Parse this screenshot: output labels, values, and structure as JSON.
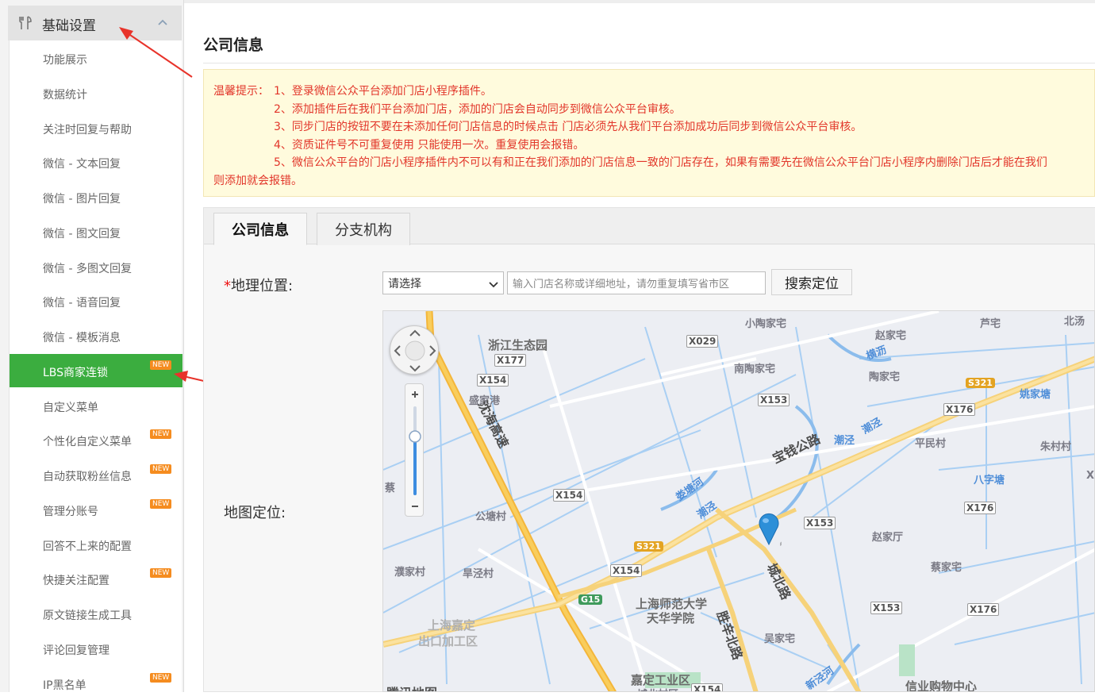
{
  "sidebar": {
    "group_title": "基础设置",
    "items": [
      {
        "label": "功能展示",
        "badge": ""
      },
      {
        "label": "数据统计",
        "badge": ""
      },
      {
        "label": "关注时回复与帮助",
        "badge": ""
      },
      {
        "label": "微信 - 文本回复",
        "badge": ""
      },
      {
        "label": "微信 - 图片回复",
        "badge": ""
      },
      {
        "label": "微信 - 图文回复",
        "badge": ""
      },
      {
        "label": "微信 - 多图文回复",
        "badge": ""
      },
      {
        "label": "微信 - 语音回复",
        "badge": ""
      },
      {
        "label": "微信 - 模板消息",
        "badge": ""
      },
      {
        "label": "LBS商家连锁",
        "badge": "NEW",
        "active": true
      },
      {
        "label": "自定义菜单",
        "badge": ""
      },
      {
        "label": "个性化自定义菜单",
        "badge": "NEW"
      },
      {
        "label": "自动获取粉丝信息",
        "badge": "NEW"
      },
      {
        "label": "管理分账号",
        "badge": "NEW"
      },
      {
        "label": "回答不上来的配置",
        "badge": ""
      },
      {
        "label": "快捷关注配置",
        "badge": "NEW"
      },
      {
        "label": "原文链接生成工具",
        "badge": ""
      },
      {
        "label": "评论回复管理",
        "badge": ""
      },
      {
        "label": "IP黑名单",
        "badge": "NEW"
      }
    ]
  },
  "page": {
    "title": "公司信息"
  },
  "notice": {
    "prefix": "温馨提示：",
    "lines": [
      "1、登录微信公众平台添加门店小程序插件。",
      "2、添加插件后在我们平台添加门店，添加的门店会自动同步到微信公众平台审核。",
      "3、同步门店的按钮不要在未添加任何门店信息的时候点击 门店必须先从我们平台添加成功后同步到微信公众平台审核。",
      "4、资质证件号不可重复使用 只能使用一次。重复使用会报错。",
      "5、微信公众平台的门店小程序插件内不可以有和正在我们添加的门店信息一致的门店存在，如果有需要先在微信公众平台门店小程序内删除门店后才能在我们",
      "则添加就会报错。"
    ]
  },
  "tabs": [
    "公司信息",
    "分支机构"
  ],
  "form": {
    "geo_required": "*",
    "geo_label": "地理位置:",
    "region_select_value": "请选择",
    "address_placeholder": "输入门店名称或详细地址，请勿重复填写省市区",
    "search_button": "搜索定位",
    "map_label": "地图定位:"
  },
  "map": {
    "logo_text": "腾讯地图",
    "labels": [
      "浙江生态园",
      "X177",
      "X154",
      "盛家港",
      "沈海高速",
      "X029",
      "小陶家宅",
      "赵家宅",
      "芦宅",
      "北汤",
      "南陶家宅",
      "横沥",
      "陶家宅",
      "S321",
      "姚家塘",
      "X153",
      "X176",
      "宝钱公路",
      "潮泾",
      "潮泾",
      "平民村",
      "朱村村",
      "X154",
      "娄塘河",
      "八字塘",
      "潮泾",
      "X176",
      "公塘村",
      "X153",
      "赵家厅",
      "S321",
      "X154",
      "蔡家宅",
      "濮家村",
      "旱泾村",
      "G15",
      "上海师范大学",
      "天华学院",
      "城北路",
      "胜辛北路",
      "X153",
      "X176",
      "上海嘉定",
      "出口加工区",
      "吴家宅",
      "嘉定工业区",
      "城北村区",
      "X154",
      "新泾河",
      "信业购物中心",
      "蔡",
      "X"
    ]
  },
  "colors": {
    "active_green": "#3bad3f",
    "badge_orange": "#f58c1f",
    "notice_red": "#e2362a",
    "notice_bg": "#fffbdd",
    "arrow_red": "#e8332a",
    "marker_blue": "#2d8fd8"
  }
}
